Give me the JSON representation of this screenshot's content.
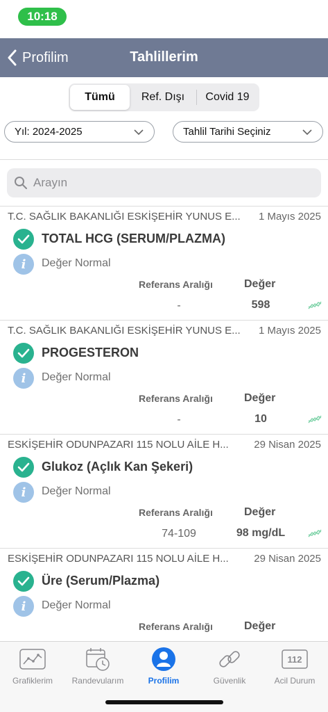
{
  "status_bar": {
    "time": "10:18"
  },
  "nav": {
    "back_label": "Profilim",
    "title": "Tahlillerim"
  },
  "segments": [
    {
      "label": "Tümü",
      "active": true
    },
    {
      "label": "Ref. Dışı",
      "active": false
    },
    {
      "label": "Covid 19",
      "active": false
    }
  ],
  "filters": {
    "year": "Yıl: 2024-2025",
    "date": "Tahlil Tarihi Seçiniz"
  },
  "search": {
    "placeholder": "Arayın",
    "value": ""
  },
  "columns": {
    "ref": "Referans Aralığı",
    "value": "Değer"
  },
  "results": [
    {
      "institution": "T.C. SAĞLIK BAKANLIĞI ESKİŞEHİR YUNUS E...",
      "date": "1 Mayıs 2025",
      "test": "TOTAL HCG (SERUM/PLAZMA)",
      "status": "Değer Normal",
      "ref": "-",
      "value": "598"
    },
    {
      "institution": "T.C. SAĞLIK BAKANLIĞI ESKİŞEHİR YUNUS E...",
      "date": "1 Mayıs 2025",
      "test": "PROGESTERON",
      "status": "Değer Normal",
      "ref": "-",
      "value": "10"
    },
    {
      "institution": "ESKİŞEHİR ODUNPAZARI 115 NOLU AİLE H...",
      "date": "29 Nisan 2025",
      "test": "Glukoz (Açlık Kan Şekeri)",
      "status": "Değer Normal",
      "ref": "74-109",
      "value": "98 mg/dL"
    },
    {
      "institution": "ESKİŞEHİR ODUNPAZARI 115 NOLU AİLE H...",
      "date": "29 Nisan 2025",
      "test": "Üre (Serum/Plazma)",
      "status": "Değer Normal",
      "ref": "",
      "value": ""
    }
  ],
  "tabs": [
    {
      "label": "Grafiklerim",
      "icon": "chart-icon",
      "active": false
    },
    {
      "label": "Randevularım",
      "icon": "calendar-clock-icon",
      "active": false
    },
    {
      "label": "Profilim",
      "icon": "person-icon",
      "active": true
    },
    {
      "label": "Güvenlik",
      "icon": "link-icon",
      "active": false
    },
    {
      "label": "Acil Durum",
      "icon": "emergency-112-icon",
      "active": false,
      "icon_text": "112"
    }
  ],
  "colors": {
    "nav_bg": "#6f7a94",
    "check_green": "#29b28f",
    "info_blue": "#9fc3e7",
    "active_tab": "#1a73e8",
    "time_pill": "#2fbf4a"
  }
}
